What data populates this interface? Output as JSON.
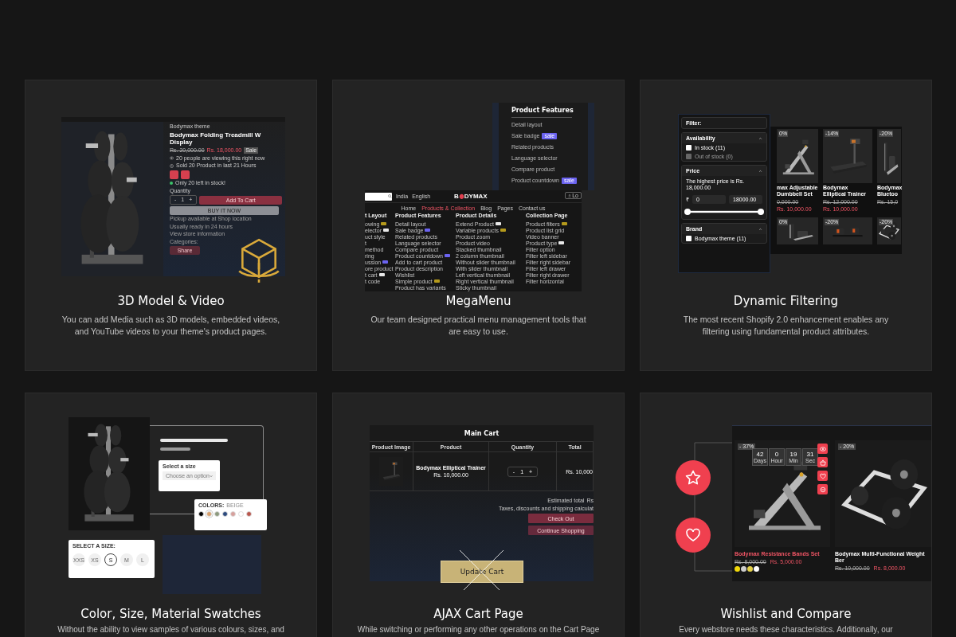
{
  "cards": [
    {
      "kind": "media",
      "title": "3D Model & Video",
      "description": "You can add Media such as 3D models, embedded videos, and YouTube videos to your theme's product pages.",
      "preview": {
        "brand": "Bodymax theme",
        "title_lines": [
          "Bodymax Folding Treadmill W",
          "Display"
        ],
        "old_price": "Rs. 20,000.00",
        "price": "Rs. 18,000.00",
        "badge": "Sale",
        "notes": [
          "20 people are viewing this right now",
          "Sold 20 Product in last 21 Hours"
        ],
        "stock": "Only 20 left in stock!",
        "quantity_label": "Quantity",
        "quantity": {
          "minus": "-",
          "value": "1",
          "plus": "+"
        },
        "add_button": "Add To Cart",
        "buy_button": "BUY IT NOW",
        "pickup": "Pickup available at Shop location",
        "ready": "Usually ready in 24 hours",
        "store_link": "View store information",
        "categories_label": "Categories:",
        "share_button": "Share"
      }
    },
    {
      "kind": "megamenu",
      "title": "MegaMenu",
      "description": "Our team designed practical menu management tools that are easy to use.",
      "preview": {
        "dropdown": {
          "heading": "Product Features",
          "items": [
            {
              "label": "Detail layout"
            },
            {
              "label": "Sale badge",
              "tag": {
                "color": "#6b63f0",
                "label": "sale"
              }
            },
            {
              "label": "Related products"
            },
            {
              "label": "Language selector"
            },
            {
              "label": "Compare product"
            },
            {
              "label": "Product countdown",
              "tag": {
                "color": "#6b63f0",
                "label": "sale"
              }
            }
          ]
        },
        "header": {
          "region": "India",
          "language": "English",
          "logo": [
            "B",
            "DYMAX"
          ],
          "account": "Lo"
        },
        "nav": [
          {
            "label": "Home",
            "selected": false
          },
          {
            "label": "Products & Collection",
            "selected": true
          },
          {
            "label": "Blog",
            "selected": false
          },
          {
            "label": "Pages",
            "selected": false
          },
          {
            "label": "Contact us",
            "selected": false
          }
        ],
        "columns": [
          {
            "heading": "t Layout",
            "items": [
              {
                "label": "owing",
                "tag": {
                  "color": "#b59a1c"
                }
              },
              {
                "label": "elector",
                "tag": {
                  "color": "#e8e8e8"
                }
              },
              {
                "label": "uct style"
              },
              {
                "label": "t"
              },
              {
                "label": "method"
              },
              {
                "label": "ring"
              },
              {
                "label": "ussion",
                "tag": {
                  "color": "#6b63f0"
                }
              },
              {
                "label": "ore product"
              },
              {
                "label": "t cart",
                "tag": {
                  "color": "#e8e8e8"
                }
              },
              {
                "label": "t code"
              }
            ]
          },
          {
            "heading": "Product Features",
            "items": [
              {
                "label": "Detail layout"
              },
              {
                "label": "Sale badge",
                "tag": {
                  "color": "#6b63f0"
                }
              },
              {
                "label": "Related products"
              },
              {
                "label": "Language selector"
              },
              {
                "label": "Compare product"
              },
              {
                "label": "Product countdown",
                "tag": {
                  "color": "#6b63f0"
                }
              },
              {
                "label": "Add to cart product"
              },
              {
                "label": "Product description"
              },
              {
                "label": "Wishlist"
              },
              {
                "label": "Simple product",
                "tag": {
                  "color": "#b59a1c"
                }
              },
              {
                "label": "Product has variants"
              }
            ]
          },
          {
            "heading": "Product Details",
            "items": [
              {
                "label": "Extend Product",
                "tag": {
                  "color": "#e8e8e8"
                }
              },
              {
                "label": "Variable products",
                "tag": {
                  "color": "#b59a1c"
                }
              },
              {
                "label": "Product zoom"
              },
              {
                "label": "Product video"
              },
              {
                "label": "Stacked thumbnail"
              },
              {
                "label": "2 column thumbnail"
              },
              {
                "label": "Without slider thumbnail"
              },
              {
                "label": "With slider thumbnail"
              },
              {
                "label": "Left vertical thumbnail"
              },
              {
                "label": "Right vertical thumbnail"
              },
              {
                "label": "Sticky thumbnail"
              }
            ]
          },
          {
            "heading": "Collection Page",
            "items": [
              {
                "label": "Product filters",
                "tag": {
                  "color": "#b59a1c"
                }
              },
              {
                "label": "Product list grid"
              },
              {
                "label": "Video banner"
              },
              {
                "label": "Product type",
                "tag": {
                  "color": "#e8e8e8"
                }
              },
              {
                "label": "Filter option"
              },
              {
                "label": "Filter left sidebar"
              },
              {
                "label": "Filter right sidebar"
              },
              {
                "label": "Filter left drawer"
              },
              {
                "label": "Filter right drawer"
              },
              {
                "label": "Filter horizontal"
              }
            ]
          }
        ]
      }
    },
    {
      "kind": "filtering",
      "title": "Dynamic Filtering",
      "description": "The most recent Shopify 2.0 enhancement enables any filtering using fundamental product attributes.",
      "preview": {
        "filter_title": "Filter:",
        "groups": [
          {
            "kind": "checklist",
            "title": "Availability",
            "expanded": true,
            "options": [
              {
                "label": "In stock (11)",
                "checked": false,
                "disabled": false
              },
              {
                "label": "Out of stock (0)",
                "checked": false,
                "disabled": true
              }
            ]
          },
          {
            "kind": "price",
            "title": "Price",
            "expanded": true,
            "note": "The highest price is Rs. 18,000.00",
            "currency": "₹",
            "min": "0",
            "max": "18000.00",
            "level": 1
          },
          {
            "kind": "checklist",
            "title": "Brand",
            "expanded": true,
            "options": [
              {
                "label": "Bodymax theme (11)",
                "checked": false,
                "disabled": false
              }
            ]
          }
        ],
        "products": [
          {
            "badge": "0%",
            "name": "max Adjustable Dumbbell Set",
            "old_price": "0,000.00",
            "price": "Rs. 10,000.00"
          },
          {
            "badge": "-14%",
            "name": "Bodymax Elliptical Trainer",
            "old_price": "Rs. 12,000.00",
            "price": "Rs. 10,000.00"
          },
          {
            "badge": "-20%",
            "name": "Bodymax Bluetoo",
            "old_price": "Rs. 15,0"
          },
          {
            "badge": "0%"
          },
          {
            "badge": "-20%"
          },
          {
            "badge": "-20%"
          }
        ]
      }
    },
    {
      "kind": "swatches",
      "title": "Color, Size, Material Swatches",
      "description": "Without the ability to view samples of various colours, sizes, and",
      "preview": {
        "select": {
          "label": "Select a size",
          "placeholder": "Choose an option"
        },
        "colors": {
          "label": "COLORS:",
          "value": "BEIGE",
          "swatches": [
            {
              "color": "#000000",
              "selected": false
            },
            {
              "color": "#d9a06c",
              "selected": true
            },
            {
              "color": "#8d9a7e",
              "selected": false
            },
            {
              "color": "#2c4a7e",
              "selected": false
            },
            {
              "color": "#d6a09c",
              "selected": false
            },
            {
              "color": "#ffffff",
              "selected": false
            },
            {
              "color": "#b9564c",
              "selected": false
            }
          ]
        },
        "sizes": {
          "label": "SELECT A SIZE:",
          "options": [
            {
              "label": "XXS",
              "selected": false
            },
            {
              "label": "XS",
              "selected": false
            },
            {
              "label": "S",
              "selected": true
            },
            {
              "label": "M",
              "selected": false
            },
            {
              "label": "L",
              "selected": false
            }
          ]
        }
      }
    },
    {
      "kind": "cart",
      "title": "AJAX Cart Page",
      "description": "While switching or performing any other operations on the Cart Page",
      "preview": {
        "heading": "Main Cart",
        "columns": [
          "Product Image",
          "Product",
          "Quantity",
          "Total"
        ],
        "row": {
          "name": "Bodymax Elliptical Trainer",
          "price": "Rs. 10,000.00",
          "quantity": {
            "minus": "-",
            "value": "1",
            "plus": "+"
          },
          "total": "Rs. 10,000"
        },
        "total_label": "Estimated total",
        "total_value": "Rs",
        "note": "Taxes, discounts and shipping calculat",
        "buttons": [
          "Check Out",
          "Continue Shopping"
        ],
        "update_button": "Update Cart"
      }
    },
    {
      "kind": "wishlist",
      "title": "Wishlist and Compare",
      "description": "Every webstore needs these characteristics. Additionally, our",
      "preview": {
        "products": [
          {
            "badge": "- 37%",
            "hovered": true,
            "countdown": [
              {
                "value": "42",
                "unit": "Days"
              },
              {
                "value": "0",
                "unit": "Hour"
              },
              {
                "value": "19",
                "unit": "Min"
              },
              {
                "value": "31",
                "unit": "Sec"
              }
            ],
            "name": "Bodymax Resistance Bands Set",
            "old_price": "Rs. 8,000.00",
            "price": "Rs. 5,000.00",
            "swatches": [
              {
                "color": "#f2d90c"
              },
              {
                "color": "#cccccc"
              },
              {
                "color": "#e2cf48"
              },
              {
                "color": "#ffffff"
              }
            ]
          },
          {
            "badge": "- 20%",
            "hovered": false,
            "name": "Bodymax Multi-Functional Weight Ber",
            "old_price": "Rs. 10,000.00",
            "price": "Rs. 8,000.00"
          }
        ]
      }
    }
  ]
}
